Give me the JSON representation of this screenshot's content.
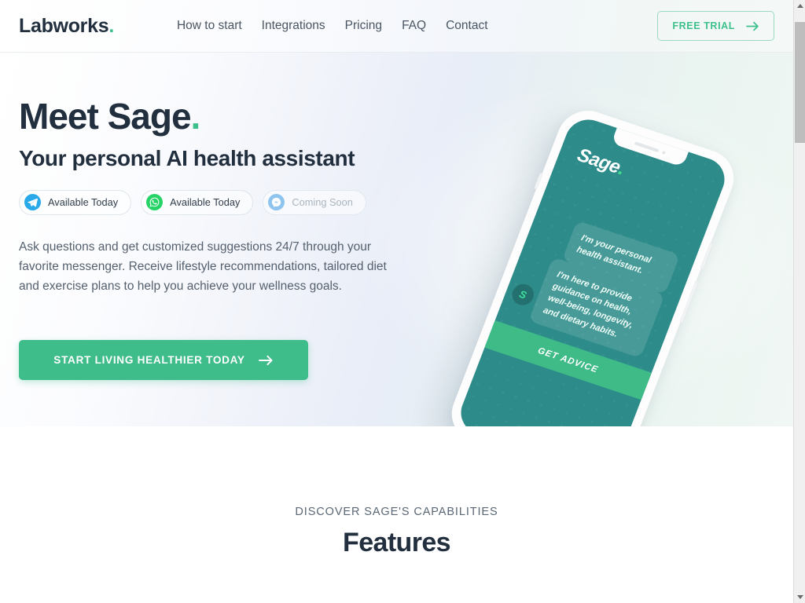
{
  "colors": {
    "brand_green": "#3ec08c",
    "cta_green": "#3ebc8a",
    "dark_navy": "#222f3e",
    "phone_teal": "#2d8b8a",
    "muted_text": "#a9b4bf"
  },
  "header": {
    "logo": "Labworks",
    "logo_dot": ".",
    "nav": [
      {
        "label": "How to start"
      },
      {
        "label": "Integrations"
      },
      {
        "label": "Pricing"
      },
      {
        "label": "FAQ"
      },
      {
        "label": "Contact"
      }
    ],
    "trial_button": {
      "label": "FREE TRIAL",
      "icon": "arrow-right-icon"
    }
  },
  "hero": {
    "title": "Meet Sage",
    "title_dot": ".",
    "subtitle": "Your personal AI health assistant",
    "chips": [
      {
        "icon": "telegram-icon",
        "label": "Available Today",
        "state": "available"
      },
      {
        "icon": "whatsapp-icon",
        "label": "Available Today",
        "state": "available"
      },
      {
        "icon": "messenger-icon",
        "label": "Coming Soon",
        "state": "coming-soon"
      }
    ],
    "body": "Ask questions and get customized suggestions 24/7 through your favorite messenger. Receive lifestyle recommendations, tailored diet and exercise plans to help you achieve your wellness goals.",
    "cta": {
      "label": "START LIVING HEALTHIER TODAY",
      "icon": "arrow-right-icon"
    }
  },
  "phone": {
    "screen_logo": "Sage",
    "screen_logo_dot": ".",
    "avatar_initial": "S",
    "messages": [
      {
        "text": "I'm your personal health assistant."
      },
      {
        "text": "I'm here to provide guidance on health, well-being, longevity, and dietary habits."
      }
    ],
    "screen_cta": "GET ADVICE"
  },
  "features": {
    "eyebrow": "DISCOVER SAGE'S CAPABILITIES",
    "title": "Features"
  },
  "scrollbar": {
    "up_icon": "chevron-up-icon",
    "down_icon": "chevron-down-icon"
  }
}
